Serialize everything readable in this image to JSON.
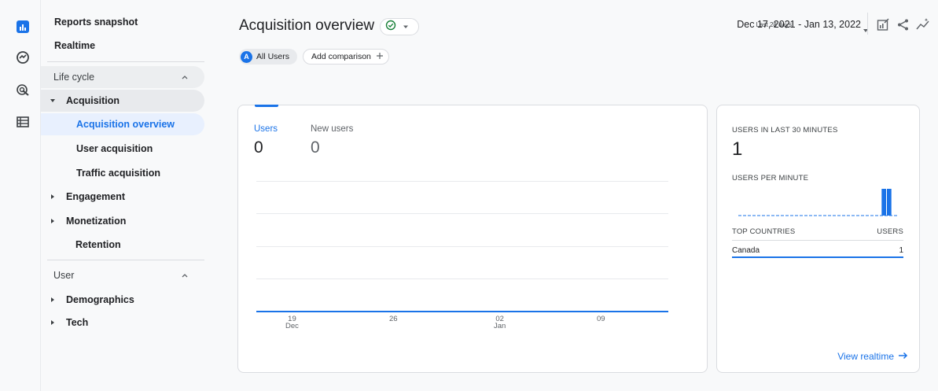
{
  "colors": {
    "accent": "#1a73e8",
    "text": "#202124",
    "muted": "#5f6368",
    "active_bg": "#e8f0fe"
  },
  "rail": {
    "icons": [
      "reports-icon",
      "explore-icon",
      "advertising-icon",
      "configure-icon"
    ]
  },
  "sidebar": {
    "top_items": [
      "Reports snapshot",
      "Realtime"
    ],
    "lifecycle": {
      "header": "Life cycle",
      "acquisition": {
        "label": "Acquisition",
        "children": [
          "Acquisition overview",
          "User acquisition",
          "Traffic acquisition"
        ]
      },
      "engagement": "Engagement",
      "monetization": "Monetization",
      "retention": "Retention"
    },
    "user": {
      "header": "User",
      "demographics": "Demographics",
      "tech": "Tech"
    }
  },
  "header": {
    "title": "Acquisition overview",
    "date_label": "Last 28 days",
    "date_range": "Dec 17, 2021 - Jan 13, 2022"
  },
  "chips": {
    "users_badge": "A",
    "users": "All Users",
    "compare": "Add comparison"
  },
  "chart_card": {
    "metrics": [
      {
        "label": "Users",
        "value": "0"
      },
      {
        "label": "New users",
        "value": "0"
      }
    ]
  },
  "chart_data": {
    "type": "line",
    "x": [
      "19 Dec",
      "26",
      "02 Jan",
      "09"
    ],
    "x_ticks": [
      {
        "top": "19",
        "bottom": "Dec"
      },
      {
        "top": "26",
        "bottom": ""
      },
      {
        "top": "02",
        "bottom": "Jan"
      },
      {
        "top": "09",
        "bottom": ""
      }
    ],
    "series": [
      {
        "values": [
          0,
          0,
          0,
          0
        ]
      }
    ],
    "grid": true,
    "legend": "none"
  },
  "realtime_card": {
    "users_label": "USERS IN LAST 30 MINUTES",
    "users_value": "1",
    "per_minute_label": "USERS PER MINUTE",
    "per_minute_bars": [
      0,
      0,
      0,
      0,
      0,
      0,
      0,
      0,
      0,
      0,
      0,
      0,
      0,
      0,
      0,
      0,
      0,
      0,
      0,
      0,
      0,
      0,
      0,
      0,
      0,
      0,
      0,
      1,
      1,
      0
    ],
    "countries_label": "TOP COUNTRIES",
    "users_col_label": "USERS",
    "countries": [
      {
        "name": "Canada",
        "value": "1"
      }
    ],
    "view_link": "View realtime"
  }
}
